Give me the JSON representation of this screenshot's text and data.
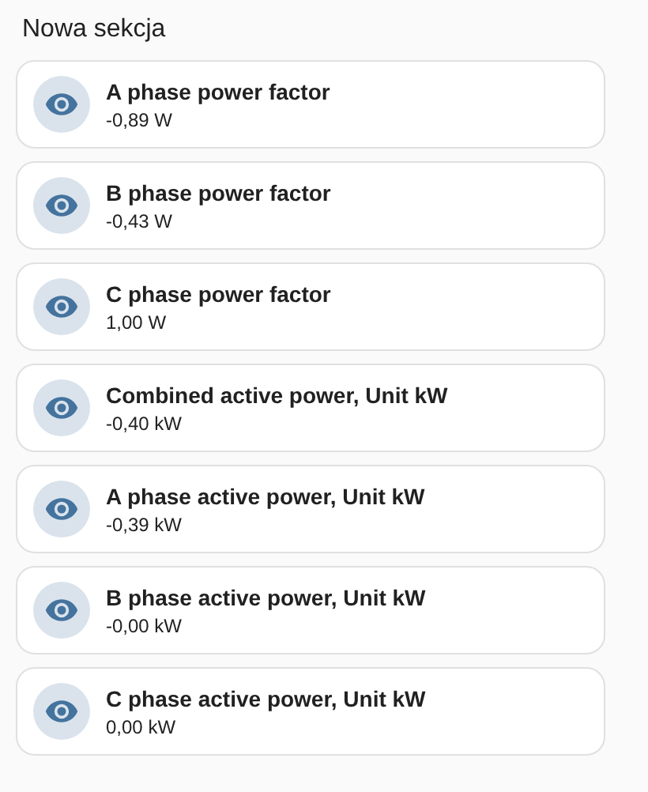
{
  "section": {
    "title": "Nowa sekcja"
  },
  "cards": [
    {
      "name": "A phase power factor",
      "state": "-0,89 W"
    },
    {
      "name": "B phase power factor",
      "state": "-0,43 W"
    },
    {
      "name": "C phase power factor",
      "state": "1,00 W"
    },
    {
      "name": "Combined active power, Unit kW",
      "state": "-0,40 kW"
    },
    {
      "name": "A phase active power, Unit kW",
      "state": "-0,39 kW"
    },
    {
      "name": "B phase active power, Unit kW",
      "state": "-0,00 kW"
    },
    {
      "name": "C phase active power, Unit kW",
      "state": "0,00 kW"
    }
  ]
}
